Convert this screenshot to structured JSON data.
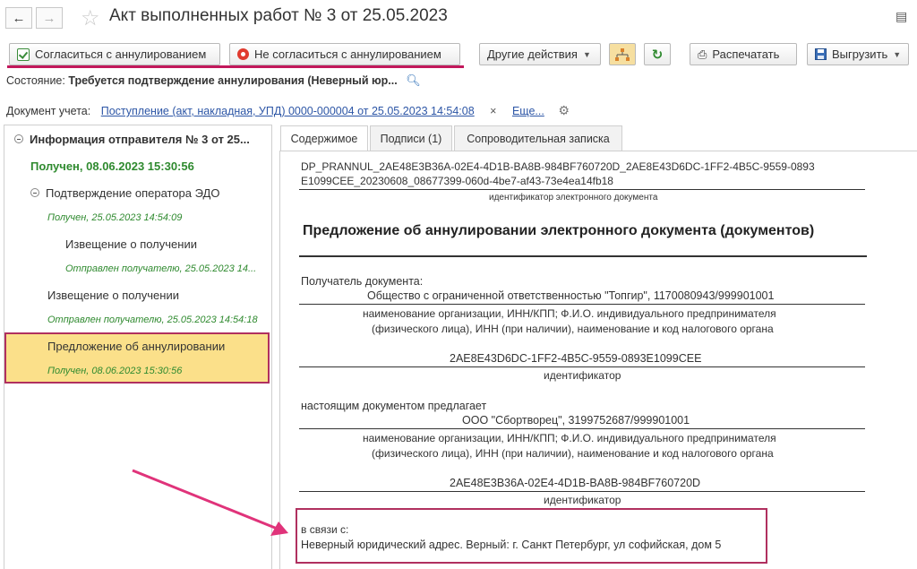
{
  "window": {
    "title": "Акт выполненных работ № 3 от 25.05.2023"
  },
  "toolbar": {
    "agree_label": "Согласиться с аннулированием",
    "disagree_label": "Не согласиться с аннулированием",
    "other_actions_label": "Другие действия",
    "print_label": "Распечатать",
    "export_label": "Выгрузить"
  },
  "state": {
    "label": "Состояние:",
    "value": "Требуется подтверждение аннулирования (Неверный юр..."
  },
  "doc_ref": {
    "label": "Документ учета:",
    "link": "Поступление (акт, накладная, УПД) 0000-000004 от 25.05.2023 14:54:08",
    "close": "×",
    "more": "Еще..."
  },
  "tree": {
    "root_title": "Информация отправителя № 3 от 25...",
    "root_status": "Получен, 08.06.2023 15:30:56",
    "operator_title": "Подтверждение оператора ЭДО",
    "operator_status": "Получен, 25.05.2023 14:54:09",
    "notice1_title": "Извещение о получении",
    "notice1_status": "Отправлен получателю, 25.05.2023 14...",
    "notice2_title": "Извещение о получении",
    "notice2_status": "Отправлен получателю, 25.05.2023 14:54:18",
    "proposal_title": "Предложение об аннулировании",
    "proposal_status": "Получен, 08.06.2023 15:30:56"
  },
  "tabs": [
    "Содержимое",
    "Подписи (1)",
    "Сопроводительная записка"
  ],
  "document": {
    "id_line1": "DP_PRANNUL_2AE48E3B36A-02E4-4D1B-BA8B-984BF760720D_2AE8E43D6DC-1FF2-4B5C-9559-0893",
    "id_line2": "E1099CEE_20230608_08677399-060d-4be7-af43-73e4ea14fb18",
    "id_caption": "идентификатор электронного документа",
    "heading": "Предложение об аннулировании электронного документа (документов)",
    "recipient_label": "Получатель документа:",
    "recipient_value": "Общество с ограниченной ответственностью \"Топгир\", 1170080943/999901001",
    "org_caption_1": "наименование организации, ИНН/КПП; Ф.И.О. индивидуального предпринимателя",
    "org_caption_2": "(физического лица), ИНН (при наличии), наименование и код налогового органа",
    "recipient_id": "2AE8E43D6DC-1FF2-4B5C-9559-0893E1099CEE",
    "id_short_caption": "идентификатор",
    "proposes_label": "настоящим документом предлагает",
    "sender_value": "ООО \"Сбортворец\", 3199752687/999901001",
    "org_caption_3": "наименование организации, ИНН/КПП; Ф.И.О. индивидуального предпринимателя",
    "org_caption_4": "(физического лица), ИНН (при наличии), наименование и код налогового органа",
    "sender_id": "2AE48E3B36A-02E4-4D1B-BA8B-984BF760720D",
    "id_short_caption_2": "идентификатор",
    "reason_label": "в связи с:",
    "reason_value": "Неверный юридический адрес. Верный: г. Санкт Петербург, ул софийская, дом 5"
  },
  "colors": {
    "highlight_border": "#b0305f",
    "selected_bg": "#fbe08a",
    "status_green": "#2f8a2f",
    "link_blue": "#2d56a6",
    "arrow_pink": "#e0337a"
  }
}
